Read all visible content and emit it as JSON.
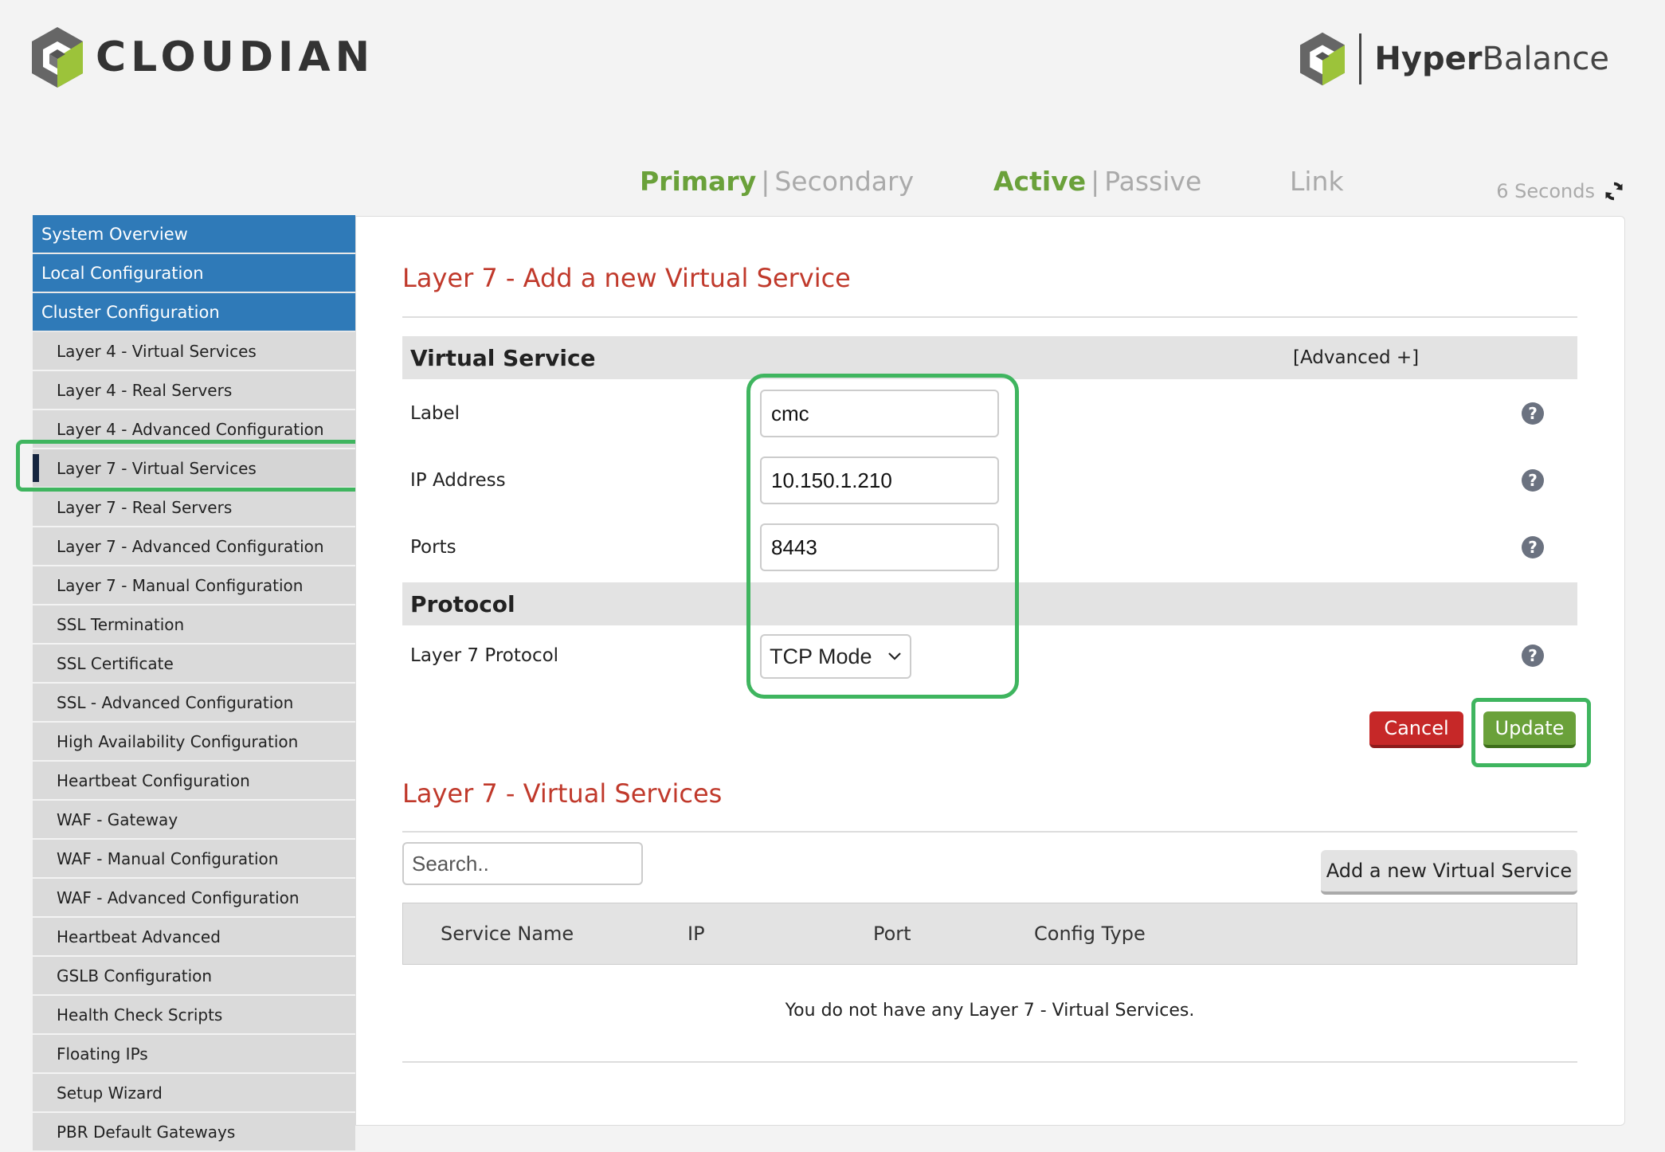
{
  "brand": {
    "left_logo": "CLOUDIAN",
    "right_logo_a": "Hyper",
    "right_logo_b": "Balance"
  },
  "status": {
    "primary": "Primary",
    "secondary": "Secondary",
    "active": "Active",
    "passive": "Passive",
    "link": "Link",
    "refresh": "6 Seconds"
  },
  "sidebar": {
    "top_items": [
      "System Overview",
      "Local Configuration",
      "Cluster Configuration"
    ],
    "sub_items": [
      "Layer 4 - Virtual Services",
      "Layer 4 - Real Servers",
      "Layer 4 - Advanced Configuration",
      "Layer 7 - Virtual Services",
      "Layer 7 - Real Servers",
      "Layer 7 - Advanced Configuration",
      "Layer 7 - Manual Configuration",
      "SSL Termination",
      "SSL Certificate",
      "SSL - Advanced Configuration",
      "High Availability Configuration",
      "Heartbeat Configuration",
      "WAF - Gateway",
      "WAF - Manual Configuration",
      "WAF - Advanced Configuration",
      "Heartbeat Advanced",
      "GSLB Configuration",
      "Health Check Scripts",
      "Floating IPs",
      "Setup Wizard",
      "PBR Default Gateways"
    ],
    "active_item": "Layer 7 - Virtual Services"
  },
  "form": {
    "title": "Layer 7 - Add a new Virtual Service",
    "section_vs": "Virtual Service",
    "advanced": "[Advanced +]",
    "label_label": "Label",
    "label_value": "cmc",
    "ip_label": "IP Address",
    "ip_value": "10.150.1.210",
    "ports_label": "Ports",
    "ports_value": "8443",
    "section_protocol": "Protocol",
    "protocol_label": "Layer 7 Protocol",
    "protocol_value": "TCP Mode",
    "help": "?",
    "cancel": "Cancel",
    "update": "Update"
  },
  "list": {
    "title": "Layer 7 - Virtual Services",
    "search_placeholder": "Search..",
    "add_button": "Add a new Virtual Service",
    "columns": [
      "Service Name",
      "IP",
      "Port",
      "Config Type"
    ],
    "empty": "You do not have any Layer 7 - Virtual Services."
  },
  "colors": {
    "accent_blue": "#2f7ab8",
    "accent_green": "#6aa13a",
    "title_red": "#c0392b",
    "highlight": "#3fb55f"
  }
}
